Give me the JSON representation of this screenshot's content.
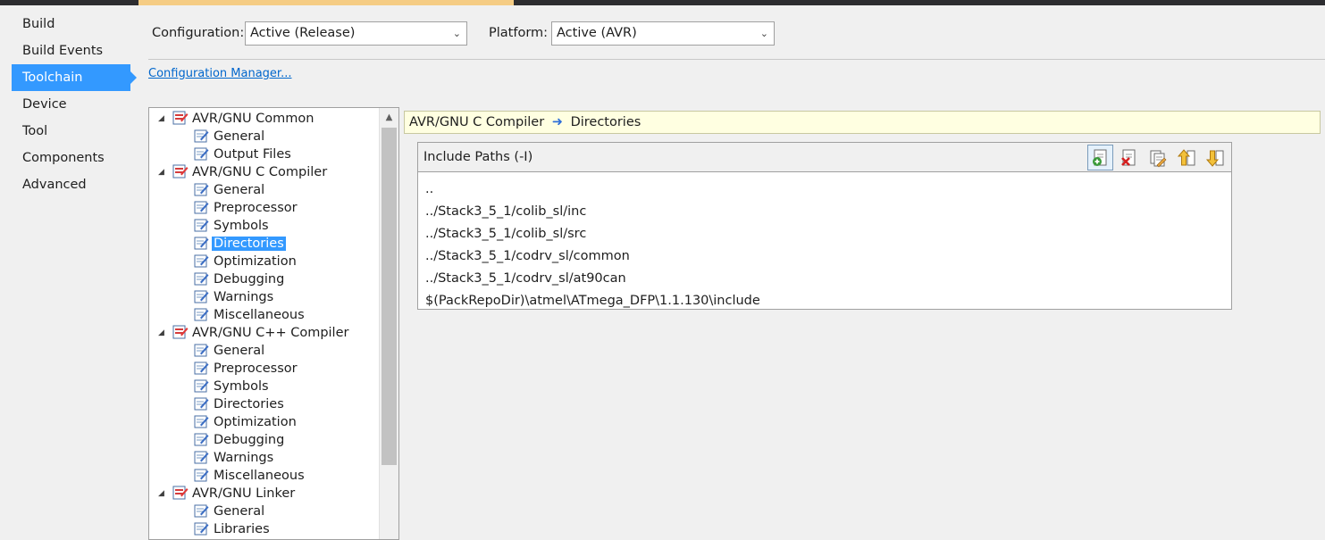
{
  "nav": {
    "items": [
      "Build",
      "Build Events",
      "Toolchain",
      "Device",
      "Tool",
      "Components",
      "Advanced"
    ],
    "active": "Toolchain"
  },
  "config": {
    "configuration_label": "Configuration:",
    "configuration_value": "Active (Release)",
    "platform_label": "Platform:",
    "platform_value": "Active (AVR)",
    "manager_link": "Configuration Manager..."
  },
  "tree": {
    "groups": [
      {
        "label": "AVR/GNU Common",
        "children": [
          "General",
          "Output Files"
        ]
      },
      {
        "label": "AVR/GNU C Compiler",
        "children": [
          "General",
          "Preprocessor",
          "Symbols",
          "Directories",
          "Optimization",
          "Debugging",
          "Warnings",
          "Miscellaneous"
        ]
      },
      {
        "label": "AVR/GNU C++ Compiler",
        "children": [
          "General",
          "Preprocessor",
          "Symbols",
          "Directories",
          "Optimization",
          "Debugging",
          "Warnings",
          "Miscellaneous"
        ]
      },
      {
        "label": "AVR/GNU Linker",
        "children": [
          "General",
          "Libraries"
        ]
      }
    ],
    "selected": "AVR/GNU C Compiler/Directories"
  },
  "breadcrumb": {
    "parent": "AVR/GNU C Compiler",
    "current": "Directories"
  },
  "include_paths": {
    "title": "Include Paths (-I)",
    "toolbar": [
      "add-item-icon",
      "delete-item-icon",
      "edit-item-icon",
      "move-up-icon",
      "move-down-icon"
    ],
    "items": [
      "..",
      "../Stack3_5_1/colib_sl/inc",
      "../Stack3_5_1/colib_sl/src",
      "../Stack3_5_1/codrv_sl/common",
      "../Stack3_5_1/codrv_sl/at90can",
      "$(PackRepoDir)\\atmel\\ATmega_DFP\\1.1.130\\include"
    ]
  },
  "colors": {
    "accent": "#3399ff",
    "link": "#0066cc",
    "breadcrumb_bg": "#ffffe1"
  }
}
